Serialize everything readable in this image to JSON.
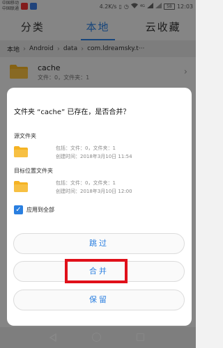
{
  "status_bar": {
    "carrier_line1": "中国移动",
    "carrier_line2": "中国联通",
    "network_speed": "4.2K/s",
    "signal_label": "4G",
    "battery": "58",
    "time": "12:03"
  },
  "tabs": [
    {
      "label": "分类",
      "active": false
    },
    {
      "label": "本地",
      "active": true
    },
    {
      "label": "云收藏",
      "active": false
    }
  ],
  "breadcrumb": [
    "本地",
    "Android",
    "data",
    "com.ldreamsky.t···"
  ],
  "folder_row": {
    "name": "cache",
    "meta": "文件：0，文件夹：1"
  },
  "dialog": {
    "title": "文件夹 “cache” 已存在，是否合并？",
    "source": {
      "label": "源文件夹",
      "contains": "包括：文件：0，文件夹：1",
      "created": "创建时间：2018年3月10日  11:54"
    },
    "target": {
      "label": "目标位置文件夹",
      "contains": "包括：文件：0，文件夹：1",
      "created": "创建时间：2018年3月10日  12:00"
    },
    "apply_all_label": "应用到全部",
    "apply_all_checked": true,
    "buttons": {
      "skip": "跳过",
      "merge": "合并",
      "keep": "保留"
    }
  },
  "colors": {
    "accent": "#2a7fe0",
    "folder": "#f5b324",
    "highlight": "#e0101a"
  }
}
